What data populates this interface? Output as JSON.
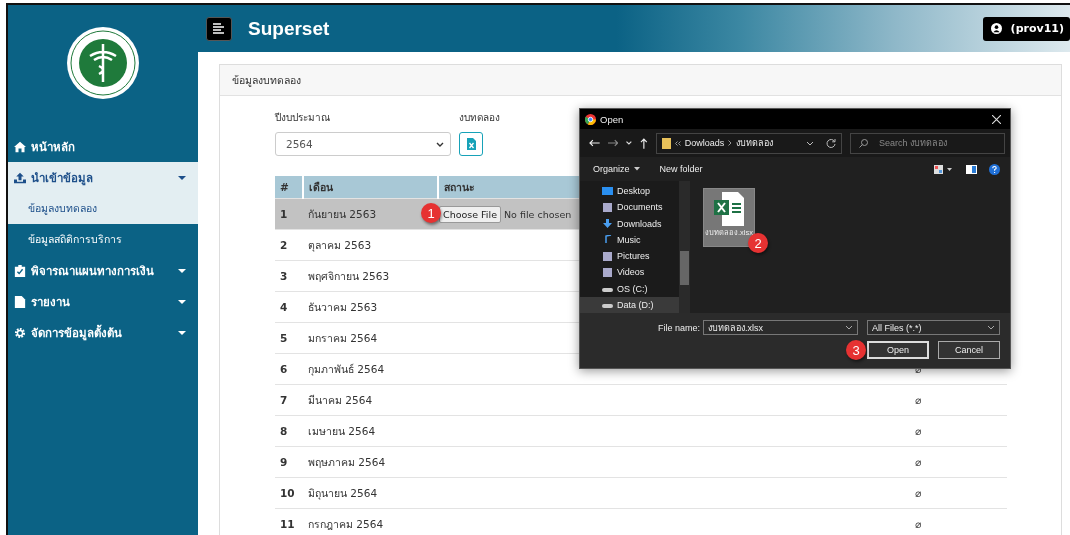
{
  "header": {
    "title": "Superset",
    "user": "(prov11)"
  },
  "sidebar": {
    "items": [
      {
        "label": "หน้าหลัก"
      },
      {
        "label": "นำเข้าข้อมูล",
        "expanded": true,
        "children": [
          {
            "label": "ข้อมูลงบทดลอง",
            "selected": true
          },
          {
            "label": "ข้อมูลสถิติการบริการ",
            "selected": false
          }
        ]
      },
      {
        "label": "พิจารณาแผนทางการเงิน",
        "expanded": false
      },
      {
        "label": "รายงาน",
        "expanded": false
      },
      {
        "label": "จัดการข้อมูลตั้งต้น",
        "expanded": false
      }
    ]
  },
  "card": {
    "title": "ข้อมูลงบทดลอง",
    "year_field": {
      "label": "ปีงบประมาณ",
      "value": "2564"
    },
    "export_label": "งบทดลอง",
    "table": {
      "columns": [
        "#",
        "เดือน",
        "สถานะ"
      ],
      "rows": [
        {
          "no": "1",
          "month": "กันยายน 2563",
          "selected": true,
          "file_input": {
            "button": "Choose File",
            "text": "No file chosen"
          }
        },
        {
          "no": "2",
          "month": "ตุลาคม 2563",
          "selected": false
        },
        {
          "no": "3",
          "month": "พฤศจิกายน 2563",
          "selected": false
        },
        {
          "no": "4",
          "month": "ธันวาคม 2563",
          "selected": false
        },
        {
          "no": "5",
          "month": "มกราคม 2564",
          "selected": false
        },
        {
          "no": "6",
          "month": "กุมภาพันธ์ 2564",
          "selected": false,
          "column_4": "⌀"
        },
        {
          "no": "7",
          "month": "มีนาคม 2564",
          "selected": false,
          "column_4": "⌀"
        },
        {
          "no": "8",
          "month": "เมษายน 2564",
          "selected": false,
          "column_4": "⌀"
        },
        {
          "no": "9",
          "month": "พฤษภาคม 2564",
          "selected": false,
          "column_4": "⌀"
        },
        {
          "no": "10",
          "month": "มิถุนายน 2564",
          "selected": false,
          "column_4": "⌀"
        },
        {
          "no": "11",
          "month": "กรกฎาคม 2564",
          "selected": false,
          "column_4": "⌀"
        }
      ]
    }
  },
  "dialog": {
    "title": "Open",
    "path": [
      "Dowloads",
      "งบทดลอง"
    ],
    "search_placeholder": "Search งบทดลอง",
    "toolbar": [
      "Organize",
      "New folder"
    ],
    "nav_items": [
      {
        "label": "Desktop",
        "selected": false
      },
      {
        "label": "Documents",
        "selected": false
      },
      {
        "label": "Downloads",
        "selected": false
      },
      {
        "label": "Music",
        "selected": false
      },
      {
        "label": "Pictures",
        "selected": false
      },
      {
        "label": "Videos",
        "selected": false
      },
      {
        "label": "OS (C:)",
        "selected": false
      },
      {
        "label": "Data (D:)",
        "selected": true
      }
    ],
    "files": [
      {
        "name": "งบทดลอง.xlsx",
        "selected": true
      }
    ],
    "file_name_label": "File name:",
    "file_name": "งบทดลอง.xlsx",
    "filter": "All Files (*.*)",
    "buttons": [
      "Open",
      "Cancel"
    ]
  },
  "steps": [
    "1",
    "2",
    "3"
  ]
}
